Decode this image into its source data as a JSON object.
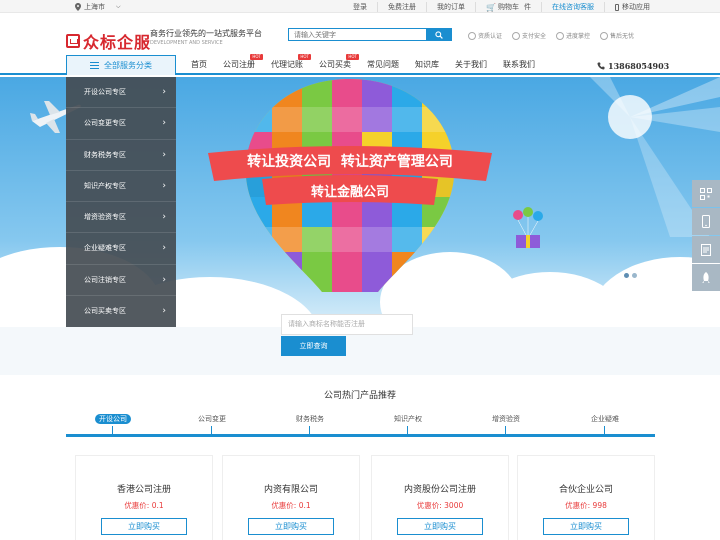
{
  "topbar": {
    "location": "上海市",
    "links": [
      {
        "label": "登录"
      },
      {
        "label": "免费注册"
      },
      {
        "label": "我的订单"
      },
      {
        "label": "购物车",
        "extra": "件"
      },
      {
        "label": "在线咨询客服"
      },
      {
        "label": "移动应用"
      }
    ]
  },
  "header": {
    "logo_text": "众标企服",
    "slogan": "商务行业领先的一站式服务平台",
    "slogan_en": "DEVELOPMENT AND SERVICE",
    "search_placeholder": "请输入关键字",
    "promises": [
      "资质认证",
      "支付安全",
      "进度掌控",
      "售后无忧"
    ]
  },
  "nav": {
    "all_categories": "全部服务分类",
    "hot_badge": "HOT",
    "items": [
      {
        "label": "首页",
        "hot": false
      },
      {
        "label": "公司注册",
        "hot": true
      },
      {
        "label": "代理记账",
        "hot": true
      },
      {
        "label": "公司买卖",
        "hot": true
      },
      {
        "label": "常见问题",
        "hot": false
      },
      {
        "label": "知识库",
        "hot": false
      },
      {
        "label": "关于我们",
        "hot": false
      },
      {
        "label": "联系我们",
        "hot": false
      }
    ],
    "phone": "13868054903"
  },
  "sidebar": {
    "items": [
      "开设公司专区",
      "公司变更专区",
      "财务税务专区",
      "知识产权专区",
      "增资验资专区",
      "企业疑难专区",
      "公司注销专区",
      "公司买卖专区"
    ]
  },
  "banner": {
    "line1": "转让投资公司  转让资产管理公司",
    "line2": "转让金融公司",
    "query_placeholder": "请输入商标名称能否注册",
    "query_button": "立即查询"
  },
  "recommend": {
    "title": "公司热门产品推荐",
    "tabs": [
      "开设公司",
      "公司变更",
      "财务税务",
      "知识产权",
      "增资验资",
      "企业疑难"
    ],
    "products": [
      {
        "name": "香港公司注册",
        "price_label": "优惠价:",
        "price": "0.1",
        "button": "立即购买"
      },
      {
        "name": "内资有限公司",
        "price_label": "优惠价:",
        "price": "0.1",
        "button": "立即购买"
      },
      {
        "name": "内资股份公司注册",
        "price_label": "优惠价:",
        "price": "3000",
        "button": "立即购买"
      },
      {
        "name": "合伙企业公司",
        "price_label": "优惠价:",
        "price": "998",
        "button": "立即购买"
      }
    ]
  },
  "colors": {
    "brand_blue": "#1a8ed0",
    "logo_red": "#d7282f",
    "price_red": "#e83a3a"
  }
}
